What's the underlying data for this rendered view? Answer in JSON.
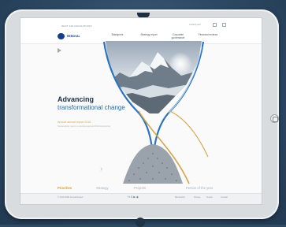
{
  "site": {
    "utility_text": "NEXT 100 NAVIGATIONS",
    "utility_right": "Α Ελληνικά",
    "logo_text": "REMOVAL",
    "nav": [
      "Basispreis",
      "Strategy report",
      "Corporate governance",
      "Financial reviews"
    ]
  },
  "hero": {
    "title_line1": "Advancing",
    "title_line2": "transformational change",
    "report_link": "Annual annual report 2016",
    "report_sub": "Sustainability report on transformational RWM-Downsizing",
    "next_arrow": "›"
  },
  "tabs": {
    "items": [
      "Priorities",
      "Strategy",
      "Projects",
      "Person of the year"
    ],
    "active_index": 0
  },
  "footer": {
    "left": "© 2016 RWE Annual Report",
    "social": "f  t  G  ▶  ◉",
    "links": [
      "Barrierefrei",
      "Privacy",
      "Imprint",
      "Contact"
    ]
  },
  "colors": {
    "accent_blue": "#1f6bb0",
    "accent_gold": "#e39c2c",
    "dark_navy": "#1b2f45"
  },
  "icons": [
    "play-icon",
    "chevron-right-icon",
    "search-icon",
    "menu-icon",
    "home-button-icon"
  ]
}
